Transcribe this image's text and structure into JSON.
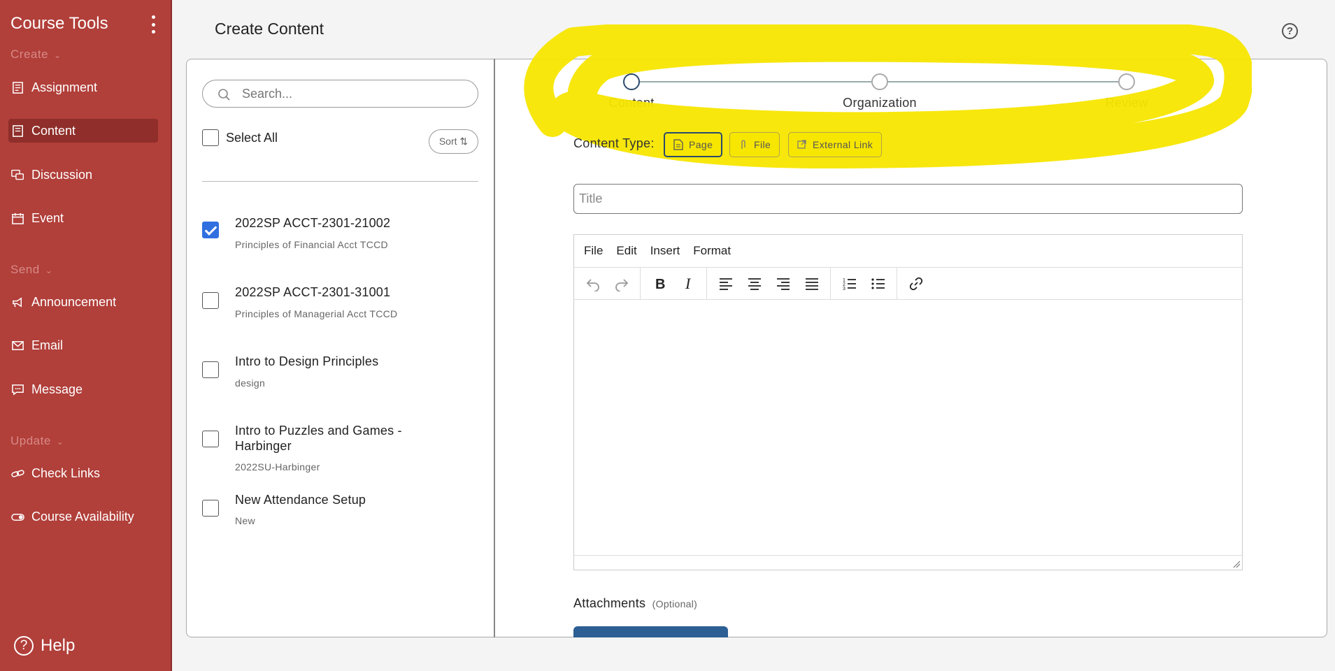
{
  "sidebar": {
    "title": "Course Tools",
    "sections": {
      "create": "Create",
      "send": "Send",
      "update": "Update"
    },
    "items": {
      "assignment": "Assignment",
      "content": "Content",
      "discussion": "Discussion",
      "event": "Event",
      "announcement": "Announcement",
      "email": "Email",
      "message": "Message",
      "check_links": "Check Links",
      "course_availability": "Course Availability"
    },
    "help": "Help"
  },
  "header": {
    "title": "Create Content"
  },
  "list": {
    "search_placeholder": "Search...",
    "select_all": "Select All",
    "sort_label": "Sort ⇅",
    "courses": [
      {
        "title": "2022SP ACCT-2301-21002",
        "subtitle": "Principles of Financial Acct TCCD",
        "checked": true
      },
      {
        "title": "2022SP ACCT-2301-31001",
        "subtitle": "Principles of Managerial Acct TCCD",
        "checked": false
      },
      {
        "title": "Intro to Design Principles",
        "subtitle": "design",
        "checked": false
      },
      {
        "title": "Intro to Puzzles and Games - Harbinger",
        "subtitle": "2022SU-Harbinger",
        "checked": false
      },
      {
        "title": "New Attendance Setup",
        "subtitle": "New",
        "checked": false
      }
    ]
  },
  "stepper": {
    "steps": [
      "Content",
      "Organization",
      "Review"
    ],
    "active_step": "Content"
  },
  "form": {
    "content_type_label": "Content Type:",
    "content_types": [
      "Page",
      "File",
      "External Link"
    ],
    "selected_type": "Page",
    "title_placeholder": "Title",
    "editor_menu": [
      "File",
      "Edit",
      "Insert",
      "Format"
    ],
    "attachments_label": "Attachments",
    "attachments_optional": "(Optional)"
  },
  "colors": {
    "sidebar_bg": "#b13f3a",
    "annotation": "#f7e600",
    "accent": "#2b4a6e",
    "checkbox": "#2f6fe0"
  }
}
